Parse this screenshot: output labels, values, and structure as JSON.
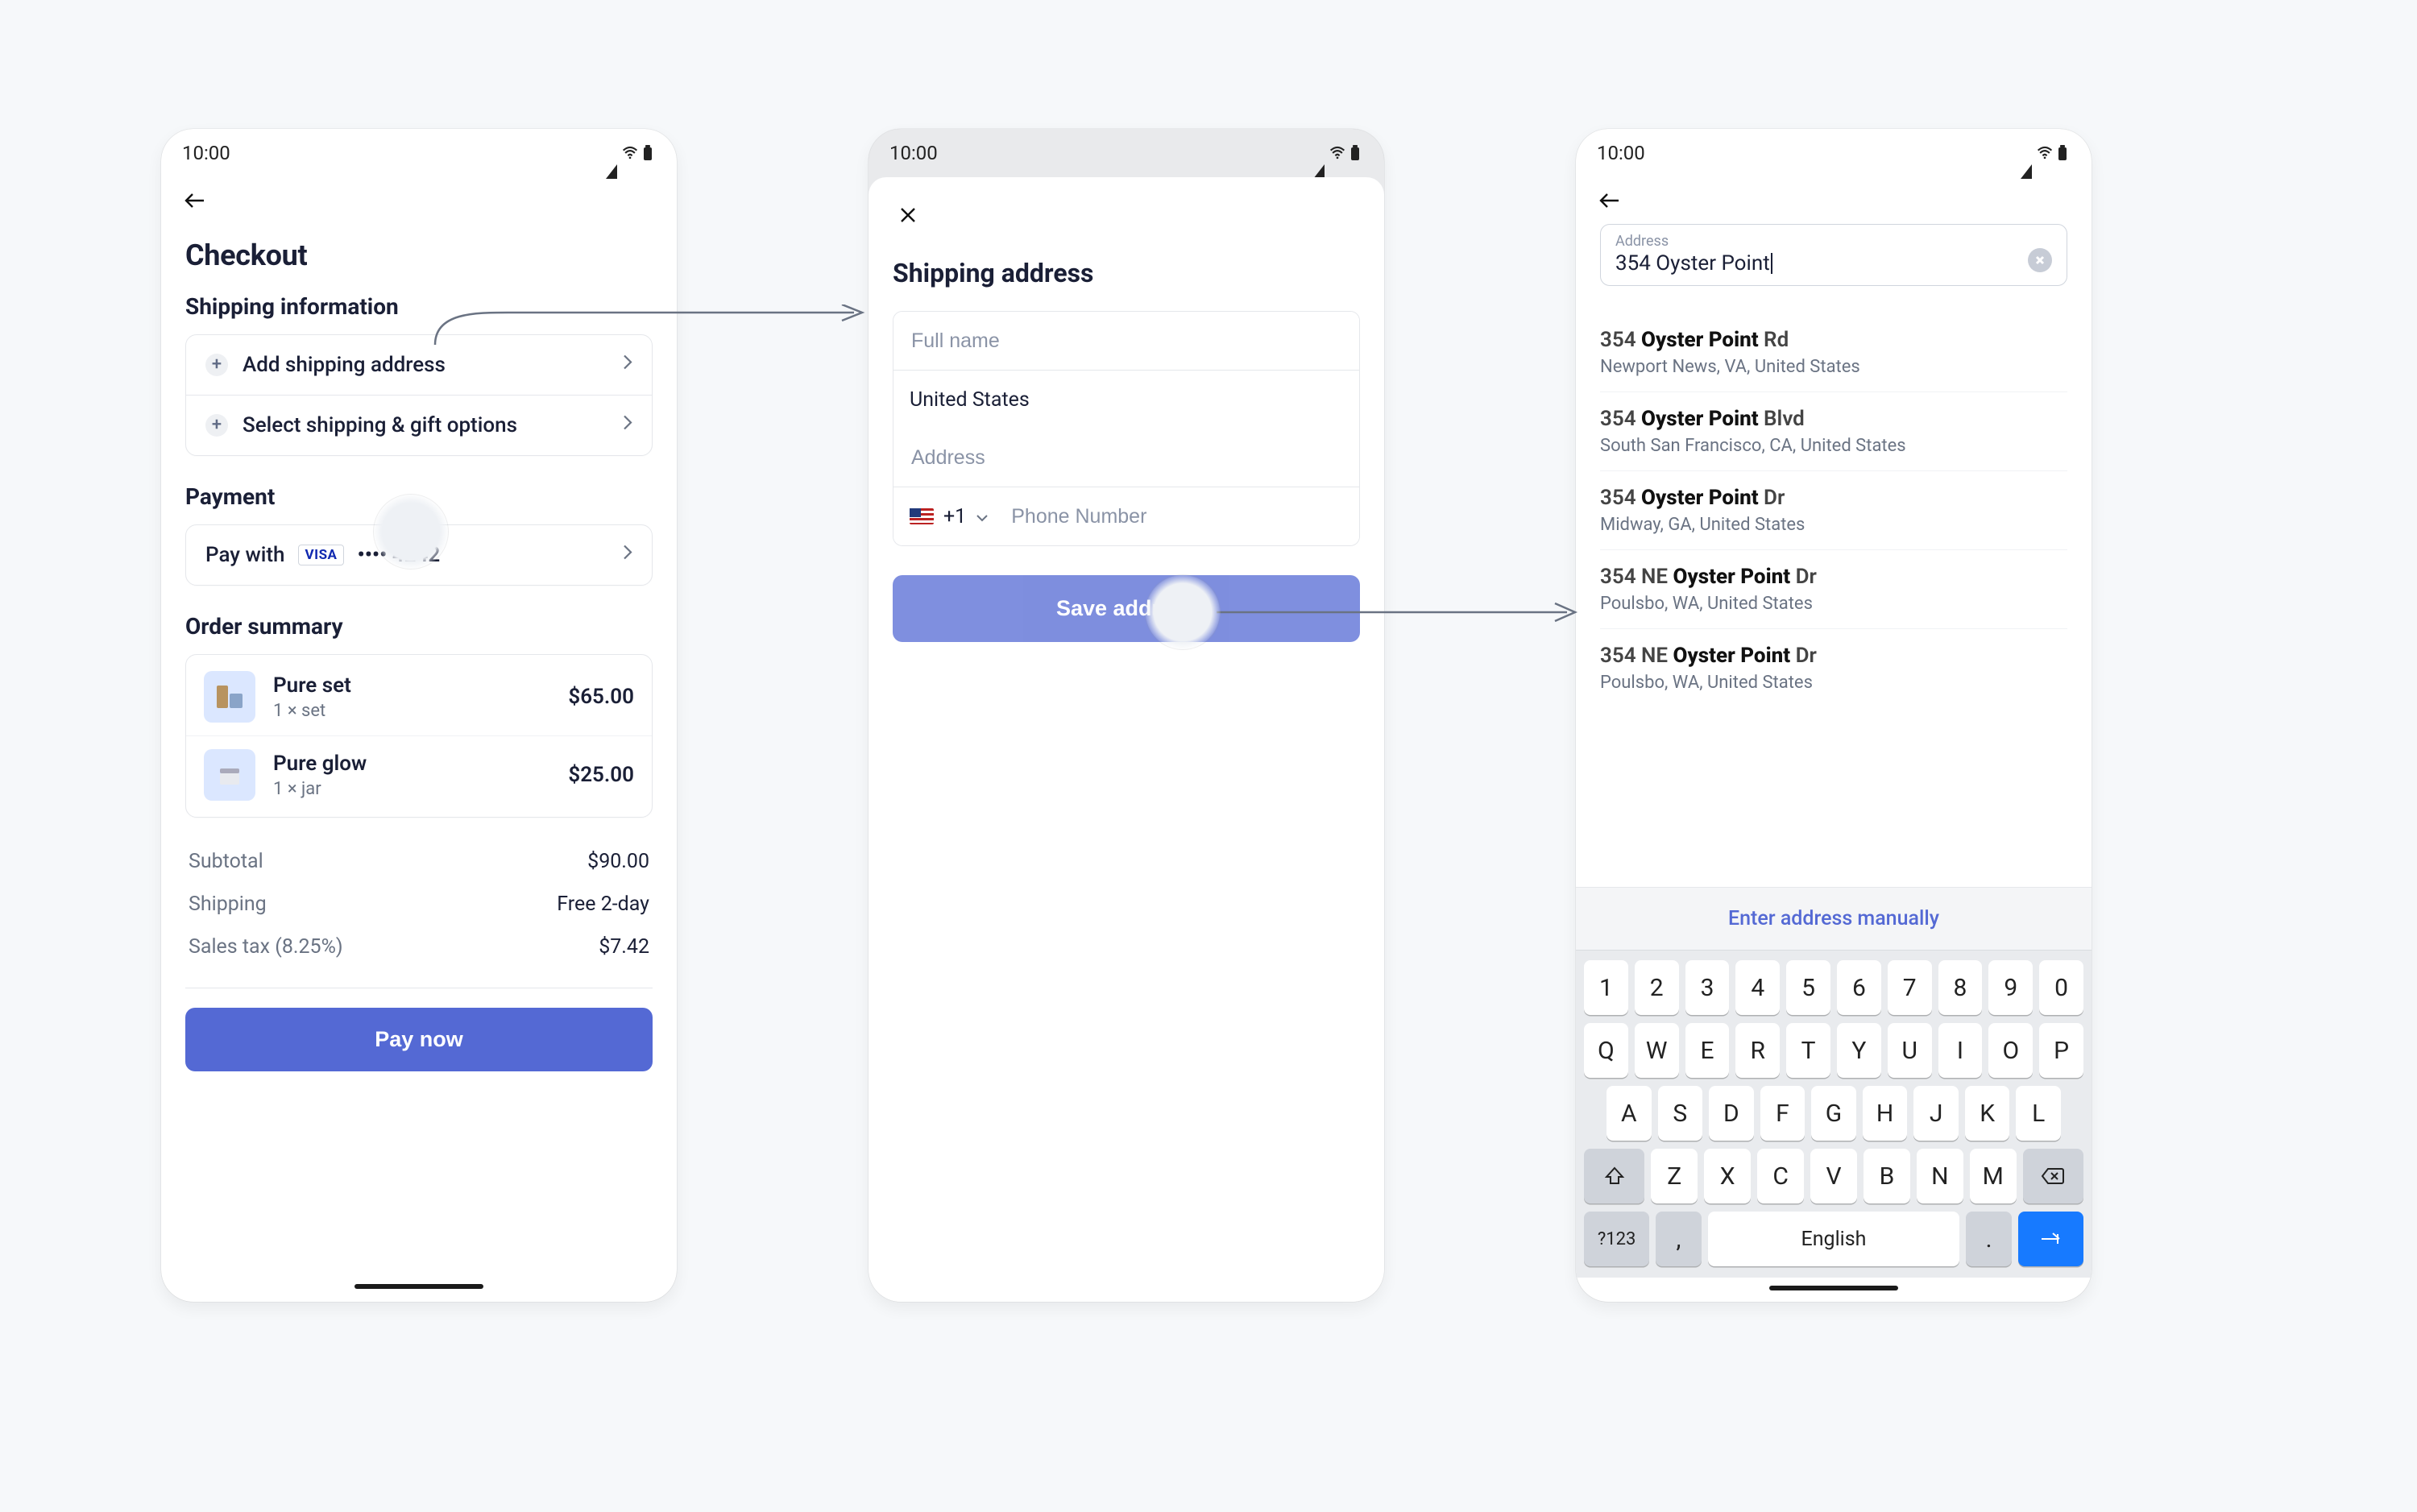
{
  "status_time": "10:00",
  "screen1": {
    "title": "Checkout",
    "shipping_label": "Shipping information",
    "add_address": "Add shipping address",
    "shipping_opts": "Select shipping & gift options",
    "payment_label": "Payment",
    "pay_with": "Pay with",
    "card_last4": "•••• 4242",
    "summary_label": "Order summary",
    "items": [
      {
        "name": "Pure set",
        "qty": "1 × set",
        "price": "$65.00"
      },
      {
        "name": "Pure glow",
        "qty": "1 × jar",
        "price": "$25.00"
      }
    ],
    "subtotal_lbl": "Subtotal",
    "subtotal_val": "$90.00",
    "shipping_lbl": "Shipping",
    "shipping_val": "Free 2-day",
    "tax_lbl": "Sales tax (8.25%)",
    "tax_val": "$7.42",
    "pay_btn": "Pay now"
  },
  "screen2": {
    "title": "Shipping address",
    "name_ph": "Full name",
    "country": "United States",
    "addr_ph": "Address",
    "dial": "+1",
    "phone_ph": "Phone Number",
    "save_btn": "Save address"
  },
  "screen3": {
    "field_label": "Address",
    "value": "354 Oyster Point",
    "suggestions": [
      {
        "l1p": "354 ",
        "l1b": "Oyster Point",
        "l1s": " Rd",
        "l2": "Newport News, VA, United States"
      },
      {
        "l1p": "354 ",
        "l1b": "Oyster Point",
        "l1s": " Blvd",
        "l2": "South San Francisco, CA, United States"
      },
      {
        "l1p": "354 ",
        "l1b": "Oyster Point",
        "l1s": " Dr",
        "l2": "Midway, GA, United States"
      },
      {
        "l1p": "354 NE ",
        "l1b": "Oyster Point",
        "l1s": " Dr",
        "l2": "Poulsbo, WA, United States"
      },
      {
        "l1p": "354 NE ",
        "l1b": "Oyster Point",
        "l1s": " Dr",
        "l2": "Poulsbo, WA, United States"
      }
    ],
    "manual": "Enter address manually",
    "kbd_row1": [
      "1",
      "2",
      "3",
      "4",
      "5",
      "6",
      "7",
      "8",
      "9",
      "0"
    ],
    "kbd_row2": [
      "Q",
      "W",
      "E",
      "R",
      "T",
      "Y",
      "U",
      "I",
      "O",
      "P"
    ],
    "kbd_row3": [
      "A",
      "S",
      "D",
      "F",
      "G",
      "H",
      "J",
      "K",
      "L"
    ],
    "kbd_row4": [
      "Z",
      "X",
      "C",
      "V",
      "B",
      "N",
      "M"
    ],
    "space_label": "English",
    "sym_key": "?123"
  }
}
